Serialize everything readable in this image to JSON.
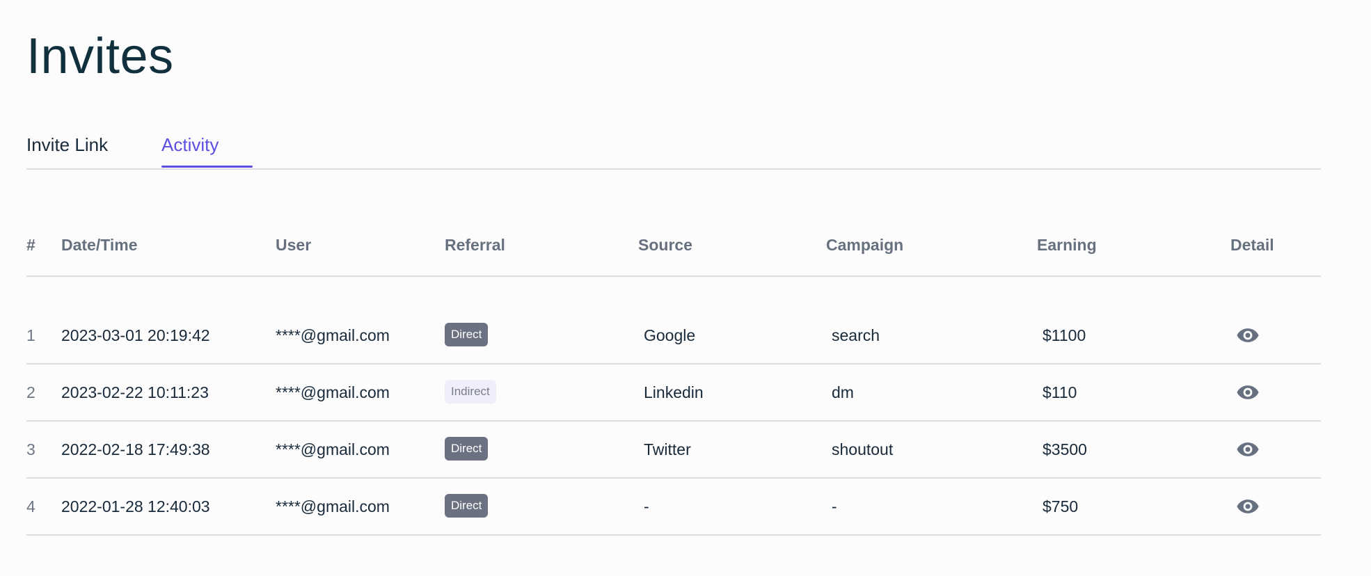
{
  "page": {
    "title": "Invites"
  },
  "tabs": [
    {
      "label": "Invite Link",
      "active": false
    },
    {
      "label": "Activity",
      "active": true
    }
  ],
  "colors": {
    "accent": "#5b4ee0",
    "badge_direct_bg": "#6b7181",
    "badge_indirect_bg": "#f1eefb",
    "muted_text": "#66707f"
  },
  "table": {
    "headers": {
      "num": "#",
      "date": "Date/Time",
      "user": "User",
      "referral": "Referral",
      "source": "Source",
      "campaign": "Campaign",
      "earning": "Earning",
      "detail": "Detail"
    },
    "rows": [
      {
        "num": "1",
        "date": "2023-03-01 20:19:42",
        "user": "****@gmail.com",
        "referral": "Direct",
        "source": "Google",
        "campaign": "search",
        "earning": "$1100",
        "detail_icon": "eye-icon"
      },
      {
        "num": "2",
        "date": "2023-02-22 10:11:23",
        "user": "****@gmail.com",
        "referral": "Indirect",
        "source": "Linkedin",
        "campaign": "dm",
        "earning": "$110",
        "detail_icon": "eye-icon"
      },
      {
        "num": "3",
        "date": "2022-02-18 17:49:38",
        "user": "****@gmail.com",
        "referral": "Direct",
        "source": "Twitter",
        "campaign": "shoutout",
        "earning": "$3500",
        "detail_icon": "eye-icon"
      },
      {
        "num": "4",
        "date": "2022-01-28 12:40:03",
        "user": "****@gmail.com",
        "referral": "Direct",
        "source": "-",
        "campaign": "-",
        "earning": "$750",
        "detail_icon": "eye-icon"
      }
    ]
  }
}
